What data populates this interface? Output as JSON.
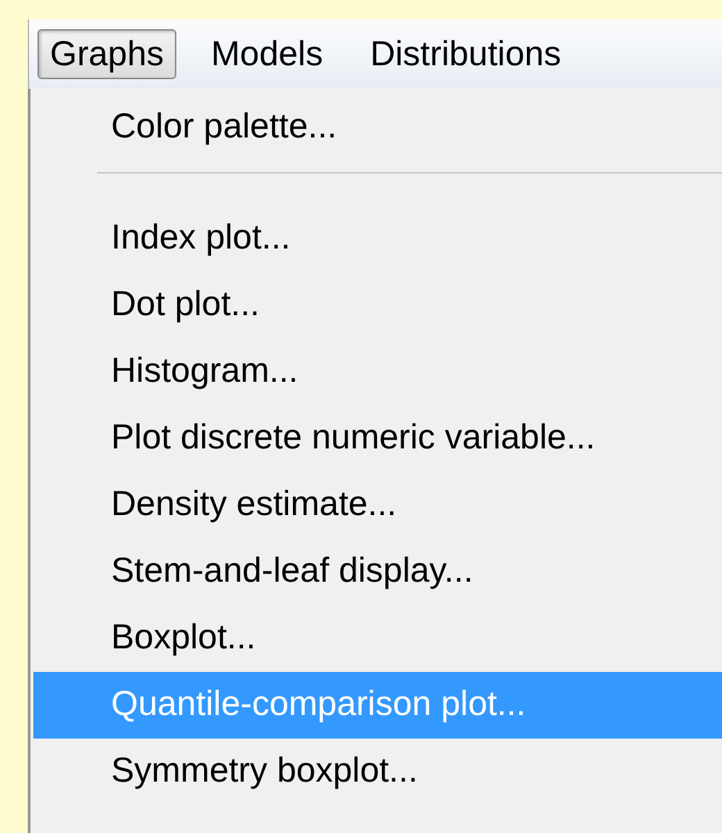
{
  "menu_bar": [
    {
      "label": "Graphs",
      "selected": true
    },
    {
      "label": "Models",
      "selected": false
    },
    {
      "label": "Distributions",
      "selected": false
    }
  ],
  "menu": [
    {
      "kind": "item",
      "label": "Color palette...",
      "selected": false
    },
    {
      "kind": "separator"
    },
    {
      "kind": "item",
      "label": "Index plot...",
      "selected": false
    },
    {
      "kind": "item",
      "label": "Dot plot...",
      "selected": false
    },
    {
      "kind": "item",
      "label": "Histogram...",
      "selected": false
    },
    {
      "kind": "item",
      "label": "Plot discrete numeric variable...",
      "selected": false
    },
    {
      "kind": "item",
      "label": "Density estimate...",
      "selected": false
    },
    {
      "kind": "item",
      "label": "Stem-and-leaf display...",
      "selected": false
    },
    {
      "kind": "item",
      "label": "Boxplot...",
      "selected": false
    },
    {
      "kind": "item",
      "label": "Quantile-comparison plot...",
      "selected": true
    },
    {
      "kind": "item",
      "label": "Symmetry boxplot...",
      "selected": false
    }
  ]
}
